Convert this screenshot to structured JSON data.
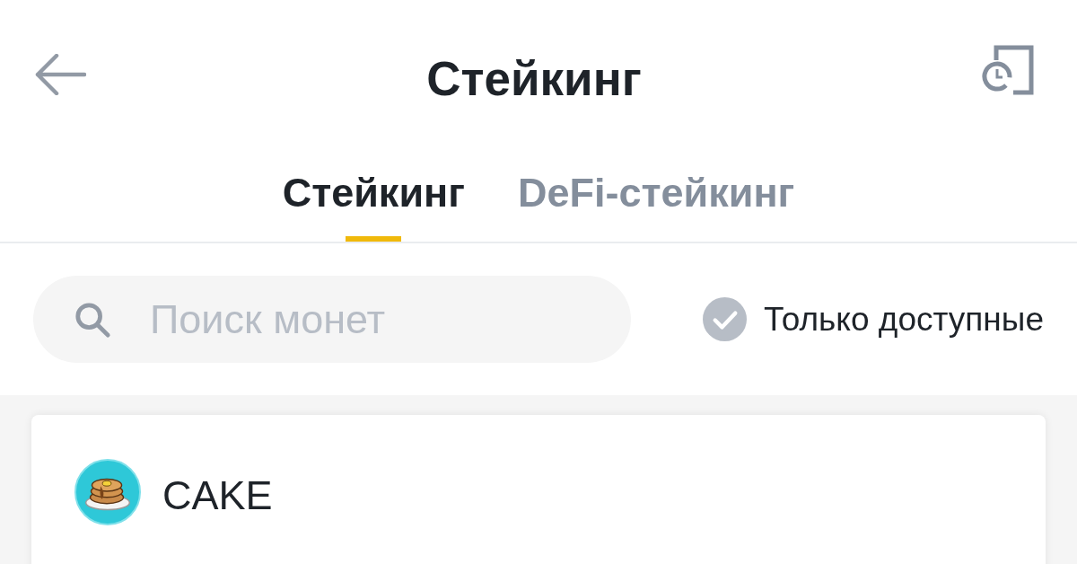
{
  "header": {
    "title": "Стейкинг"
  },
  "tabs": [
    {
      "label": "Стейкинг",
      "selected": true
    },
    {
      "label": "DeFi-стейкинг",
      "selected": false
    }
  ],
  "search": {
    "placeholder": "Поиск монет"
  },
  "filter": {
    "label": "Только доступные",
    "checked": false
  },
  "coins": [
    {
      "symbol": "CAKE"
    }
  ]
}
